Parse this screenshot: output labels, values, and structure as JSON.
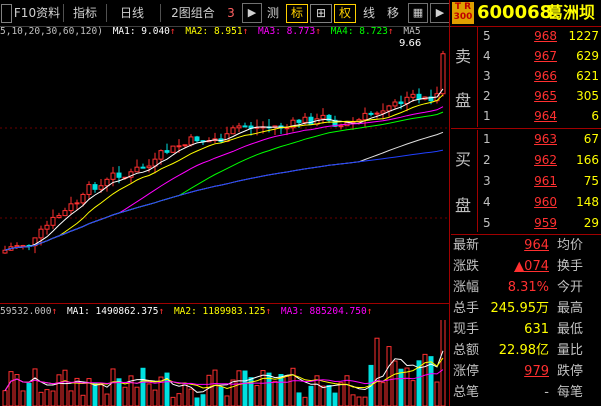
{
  "toolbar": {
    "items": [
      {
        "label": "F10资料"
      },
      {
        "label": "指标"
      },
      {
        "label": "日线"
      },
      {
        "label": "2图组合"
      },
      {
        "label": "3"
      },
      {
        "label": "▶"
      },
      {
        "label": "测"
      },
      {
        "label": "标"
      },
      {
        "label": "⊞"
      },
      {
        "label": "权"
      },
      {
        "label": "线"
      },
      {
        "label": "移"
      }
    ]
  },
  "ma_line": {
    "prefix": "5,10,20,30,60,120)",
    "ma1": "MA1: 9.040",
    "ma2": "MA2: 8.951",
    "ma3": "MA3: 8.773",
    "ma4": "MA4: 8.723",
    "ma5": "MA5",
    "colors": {
      "ma1": "#ffffff",
      "ma2": "#ffff00",
      "ma3": "#ff00ff",
      "ma4": "#00ff00",
      "ma5": "#ffffff"
    }
  },
  "chart": {
    "high_label": "9.66"
  },
  "vol_line": {
    "vol": "59532.000",
    "ma1": "MA1: 1490862.375",
    "ma2": "MA2: 1189983.125",
    "ma3": "MA3: 885204.750"
  },
  "quote": {
    "badge_top": "T R",
    "badge_bottom": "300",
    "code": "600068",
    "name": "葛洲坝",
    "sell_side_label_1": "卖",
    "sell_side_label_2": "盘",
    "buy_side_label_1": "买",
    "buy_side_label_2": "盘",
    "asks": [
      {
        "idx": "5",
        "price": "968",
        "vol": "1227"
      },
      {
        "idx": "4",
        "price": "967",
        "vol": "629"
      },
      {
        "idx": "3",
        "price": "966",
        "vol": "621"
      },
      {
        "idx": "2",
        "price": "965",
        "vol": "305"
      },
      {
        "idx": "1",
        "price": "964",
        "vol": "6"
      }
    ],
    "bids": [
      {
        "idx": "1",
        "price": "963",
        "vol": "67"
      },
      {
        "idx": "2",
        "price": "962",
        "vol": "166"
      },
      {
        "idx": "3",
        "price": "961",
        "vol": "75"
      },
      {
        "idx": "4",
        "price": "960",
        "vol": "148"
      },
      {
        "idx": "5",
        "price": "959",
        "vol": "29"
      }
    ],
    "stats": [
      {
        "label": "最新",
        "value": "964",
        "label2": "均价",
        "color": "#ff3030"
      },
      {
        "label": "涨跌",
        "value": "▲074",
        "label2": "换手",
        "color": "#ff3030"
      },
      {
        "label": "涨幅",
        "value": "8.31%",
        "label2": "今开",
        "color": "#ff3030"
      },
      {
        "label": "总手",
        "value": "245.95万",
        "label2": "最高",
        "color": "#ffff00"
      },
      {
        "label": "现手",
        "value": "631",
        "label2": "最低",
        "color": "#ffff00"
      },
      {
        "label": "总额",
        "value": "22.98亿",
        "label2": "量比",
        "color": "#ffff00"
      },
      {
        "label": "涨停",
        "value": "979",
        "label2": "跌停",
        "color": "#ff3030"
      },
      {
        "label": "总笔",
        "value": "-",
        "label2": "每笔",
        "color": "#c0c0c0"
      }
    ]
  },
  "colors": {
    "up": "#ff3030",
    "down": "#00e0e0",
    "background": "#000000",
    "grid": "#a00000"
  }
}
